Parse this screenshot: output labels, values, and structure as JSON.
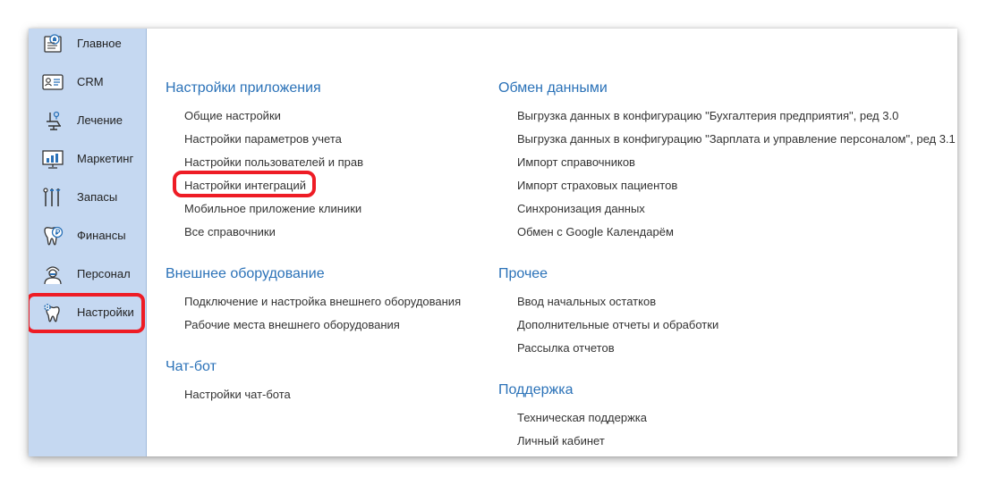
{
  "sidebar": {
    "items": [
      {
        "label": "Главное",
        "icon": "home-icon"
      },
      {
        "label": "CRM",
        "icon": "contact-card-icon"
      },
      {
        "label": "Лечение",
        "icon": "dental-chair-icon"
      },
      {
        "label": "Маркетинг",
        "icon": "chart-board-icon"
      },
      {
        "label": "Запасы",
        "icon": "dental-tools-icon"
      },
      {
        "label": "Финансы",
        "icon": "tooth-ruble-icon"
      },
      {
        "label": "Персонал",
        "icon": "doctor-icon"
      },
      {
        "label": "Настройки",
        "icon": "tooth-gear-icon"
      }
    ],
    "active": "Настройки"
  },
  "main": {
    "left": [
      {
        "title": "Настройки приложения",
        "links": [
          "Общие настройки",
          "Настройки параметров учета",
          "Настройки пользователей и прав",
          "Настройки интеграций",
          "Мобильное приложение клиники",
          "Все справочники"
        ]
      },
      {
        "title": "Внешнее оборудование",
        "links": [
          "Подключение и настройка внешнего оборудования",
          "Рабочие места внешнего оборудования"
        ]
      },
      {
        "title": "Чат-бот",
        "links": [
          "Настройки чат-бота"
        ]
      }
    ],
    "right": [
      {
        "title": "Обмен данными",
        "links": [
          "Выгрузка данных в конфигурацию \"Бухгалтерия предприятия\", ред 3.0",
          "Выгрузка данных в конфигурацию \"Зарплата и управление персоналом\", ред 3.1",
          "Импорт справочников",
          "Импорт страховых пациентов",
          "Синхронизация данных",
          "Обмен с Google Календарём"
        ]
      },
      {
        "title": "Прочее",
        "links": [
          "Ввод начальных остатков",
          "Дополнительные отчеты и обработки",
          "Рассылка отчетов"
        ]
      },
      {
        "title": "Поддержка",
        "links": [
          "Техническая поддержка",
          "Личный кабинет"
        ]
      }
    ]
  },
  "colors": {
    "sidebar_bg": "#c5d8f1",
    "section_title": "#2b72b8",
    "highlight": "#ee1c25"
  }
}
